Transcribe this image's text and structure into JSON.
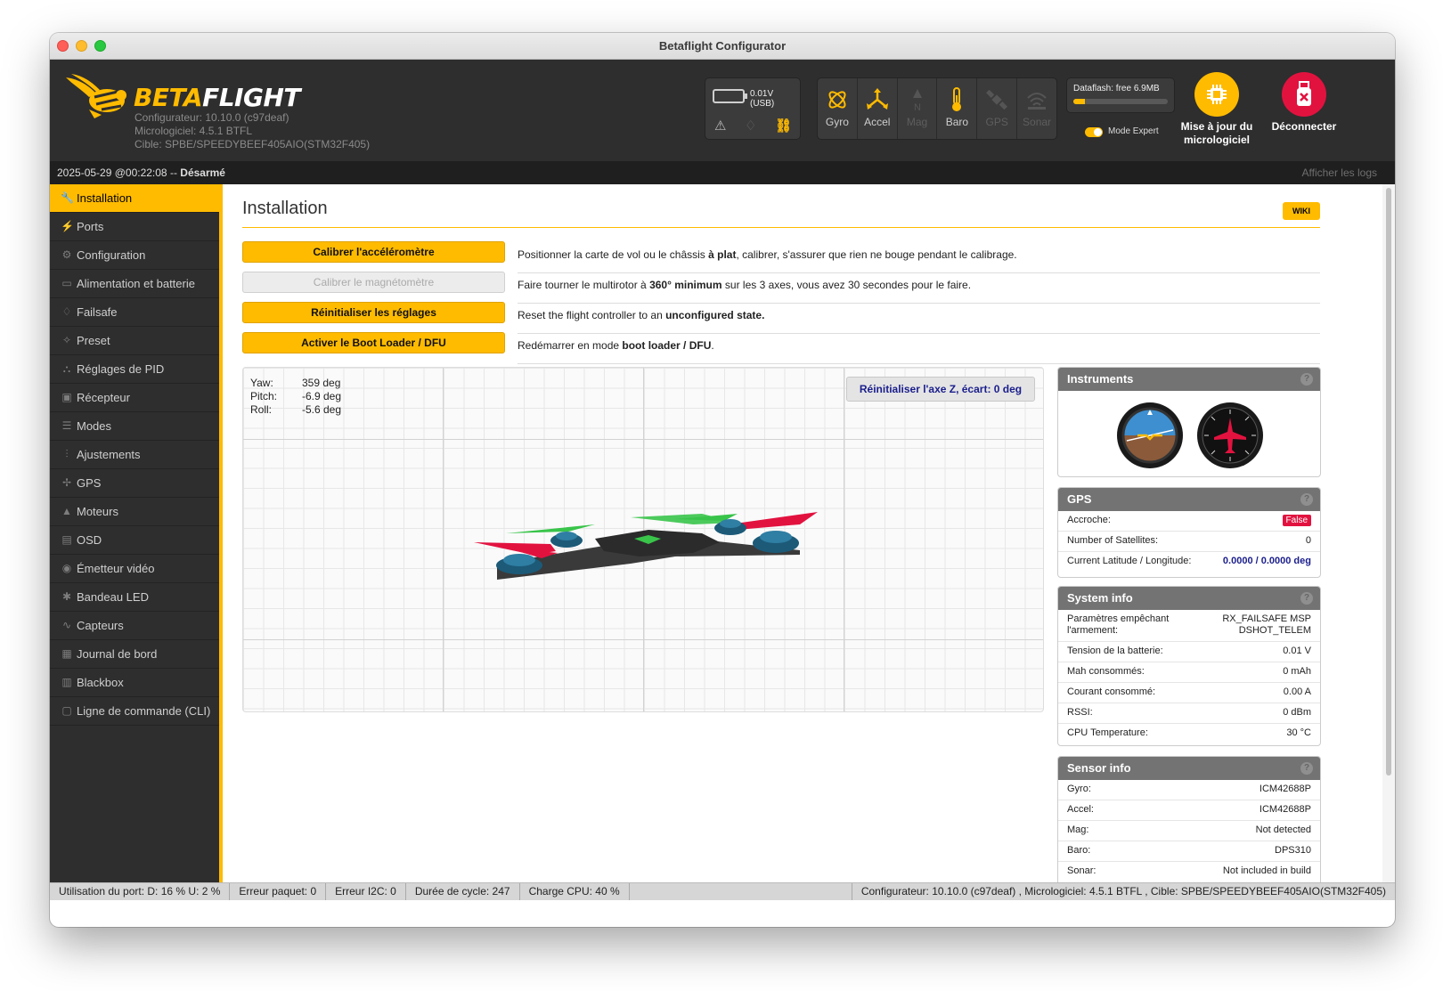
{
  "window": {
    "title": "Betaflight Configurator"
  },
  "header": {
    "brand_part1": "BETA",
    "brand_part2": "FLIGHT",
    "configurator_version": "Configurateur: 10.10.0 (c97deaf)",
    "firmware_version": "Micrologiciel: 4.5.1 BTFL",
    "target": "Cible: SPBE/SPEEDYBEEF405AIO(STM32F405)",
    "battery_voltage": "0.01V (USB)",
    "sensors": [
      {
        "label": "Gyro",
        "icon": "gyro-icon",
        "active": true
      },
      {
        "label": "Accel",
        "icon": "accel-icon",
        "active": true
      },
      {
        "label": "Mag",
        "icon": "mag-icon",
        "active": false
      },
      {
        "label": "Baro",
        "icon": "baro-icon",
        "active": true
      },
      {
        "label": "GPS",
        "icon": "gps-icon",
        "active": false
      },
      {
        "label": "Sonar",
        "icon": "sonar-icon",
        "active": false
      }
    ],
    "dataflash_label": "Dataflash: free 6.9MB",
    "dataflash_used_fraction": 0.12,
    "expert_mode_label": "Mode Expert",
    "expert_mode_on": true,
    "firmware_update_label": "Mise à jour du micrologiciel",
    "disconnect_label": "Déconnecter"
  },
  "status_top": {
    "datetime": "2025-05-29 @00:22:08 -- ",
    "arm_state": "Désarmé",
    "show_logs": "Afficher les logs"
  },
  "sidebar": {
    "items": [
      {
        "label": "Installation",
        "icon": "wrench-icon",
        "active": true
      },
      {
        "label": "Ports",
        "icon": "plug-icon"
      },
      {
        "label": "Configuration",
        "icon": "gear-icon"
      },
      {
        "label": "Alimentation et batterie",
        "icon": "battery-icon"
      },
      {
        "label": "Failsafe",
        "icon": "parachute-icon"
      },
      {
        "label": "Preset",
        "icon": "magic-icon"
      },
      {
        "label": "Réglages de PID",
        "icon": "pid-icon"
      },
      {
        "label": "Récepteur",
        "icon": "receiver-icon"
      },
      {
        "label": "Modes",
        "icon": "modes-icon"
      },
      {
        "label": "Ajustements",
        "icon": "sliders-icon"
      },
      {
        "label": "GPS",
        "icon": "satellite-icon"
      },
      {
        "label": "Moteurs",
        "icon": "motor-icon"
      },
      {
        "label": "OSD",
        "icon": "osd-icon"
      },
      {
        "label": "Émetteur vidéo",
        "icon": "vtx-icon"
      },
      {
        "label": "Bandeau LED",
        "icon": "led-icon"
      },
      {
        "label": "Capteurs",
        "icon": "sensors-icon"
      },
      {
        "label": "Journal de bord",
        "icon": "log-icon"
      },
      {
        "label": "Blackbox",
        "icon": "blackbox-icon"
      },
      {
        "label": "Ligne de commande (CLI)",
        "icon": "cli-icon"
      }
    ]
  },
  "main": {
    "title": "Installation",
    "wiki": "WIKI",
    "actions": [
      {
        "label": "Calibrer l'accéléromètre",
        "enabled": true,
        "desc_pre": "Positionner la carte de vol ou le châssis ",
        "desc_bold": "à plat",
        "desc_post": ", calibrer, s'assurer que rien ne bouge pendant le calibrage."
      },
      {
        "label": "Calibrer le magnétomètre",
        "enabled": false,
        "desc_pre": "Faire tourner le multirotor à ",
        "desc_bold": "360° minimum",
        "desc_post": " sur les 3 axes, vous avez 30 secondes pour le faire."
      },
      {
        "label": "Réinitialiser les réglages",
        "enabled": true,
        "desc_pre": "Reset the flight controller to an ",
        "desc_bold": "unconfigured state.",
        "desc_post": ""
      },
      {
        "label": "Activer le Boot Loader / DFU",
        "enabled": true,
        "desc_pre": "Redémarrer en mode ",
        "desc_bold": "boot loader / DFU",
        "desc_post": "."
      }
    ],
    "attitude": {
      "yaw_label": "Yaw:",
      "yaw": "359 deg",
      "pitch_label": "Pitch:",
      "pitch": "-6.9 deg",
      "roll_label": "Roll:",
      "roll": "-5.6 deg"
    },
    "reset_z_label": "Réinitialiser l'axe Z, écart: 0 deg"
  },
  "instruments": {
    "title": "Instruments",
    "help": "?"
  },
  "gps": {
    "title": "GPS",
    "help": "?",
    "rows": [
      {
        "k": "Accroche:",
        "v": "False"
      },
      {
        "k": "Number of Satellites:",
        "v": "0"
      },
      {
        "k": "Current Latitude / Longitude:",
        "v": "0.0000 / 0.0000 deg"
      }
    ]
  },
  "system_info": {
    "title": "System info",
    "help": "?",
    "arming_label": "Paramètres empêchant l'armement:",
    "arming_flags_1": "RX_FAILSAFE  MSP",
    "arming_flags_2": "DSHOT_TELEM",
    "rows": [
      {
        "k": "Tension de la batterie:",
        "v": "0.01 V"
      },
      {
        "k": "Mah consommés:",
        "v": "0 mAh"
      },
      {
        "k": "Courant consommé:",
        "v": "0.00 A"
      },
      {
        "k": "RSSI:",
        "v": "0 dBm"
      },
      {
        "k": "CPU Temperature:",
        "v": "30 °C"
      }
    ]
  },
  "sensor_info": {
    "title": "Sensor info",
    "help": "?",
    "rows": [
      {
        "k": "Gyro:",
        "v": "ICM42688P"
      },
      {
        "k": "Accel:",
        "v": "ICM42688P"
      },
      {
        "k": "Mag:",
        "v": "Not detected"
      },
      {
        "k": "Baro:",
        "v": "DPS310"
      },
      {
        "k": "Sonar:",
        "v": "Not included in build"
      }
    ]
  },
  "status_bottom": {
    "port_usage": "Utilisation du port: D: 16 % U: 2 %",
    "packet_error": "Erreur paquet: 0",
    "i2c_error": "Erreur I2C: 0",
    "cycle_time": "Durée de cycle: 247",
    "cpu_load": "Charge CPU: 40 %",
    "versions": "Configurateur: 10.10.0 (c97deaf) , Micrologiciel: 4.5.1 BTFL , Cible: SPBE/SPEEDYBEEF405AIO(STM32F405)"
  },
  "colors": {
    "accent": "#ffbb00",
    "header_bg": "#2e2e2e",
    "sidebar_bg": "#2e2e2e",
    "danger": "#e2123f"
  }
}
